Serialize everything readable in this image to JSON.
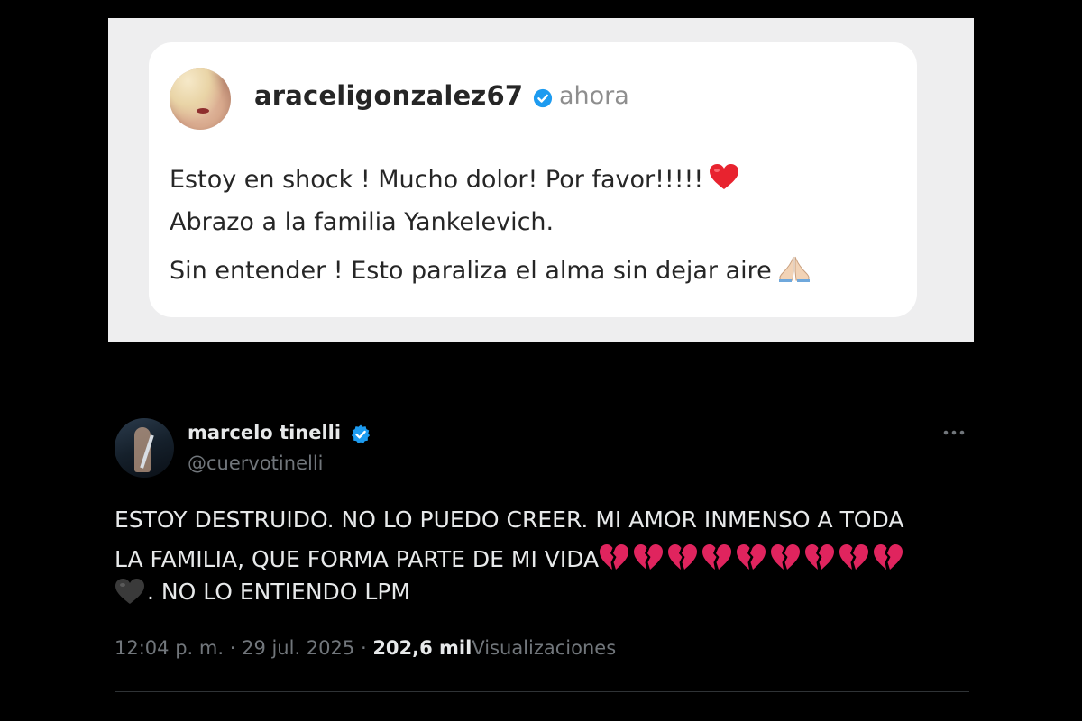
{
  "instagram_post": {
    "username": "araceligonzalez67",
    "time": "ahora",
    "line1": "Estoy en shock ! Mucho dolor! Por favor!!!!!",
    "line2": "Abrazo a la familia Yankelevich.",
    "line3": "Sin entender ! Esto paraliza el alma sin dejar aire",
    "line1_emoji": "red-heart",
    "line3_emoji": "folded-hands"
  },
  "tweet": {
    "display_name": "marcelo tinelli",
    "handle": "@cuervotinelli",
    "line1": "ESTOY DESTRUIDO. NO LO PUEDO CREER. MI AMOR INMENSO A TODA",
    "line2": "LA FAMILIA, QUE FORMA PARTE DE MI VIDA",
    "line3": ". NO LO ENTIENDO LPM",
    "broken_heart_count": 9,
    "line3_emoji": "black-heart",
    "time": "12:04 p. m.",
    "separator1": "·",
    "date": "29 jul. 2025",
    "separator2": "·",
    "views_count": "202,6 mil",
    "views_label": "Visualizaciones"
  },
  "colors": {
    "background": "#000000",
    "ig_panel": "#eeeeef",
    "ig_card": "#ffffff",
    "verified_blue": "#1d9bf0",
    "tw_text": "#e7e9ea",
    "tw_muted": "#71767b",
    "broken_heart": "#e0245e"
  }
}
